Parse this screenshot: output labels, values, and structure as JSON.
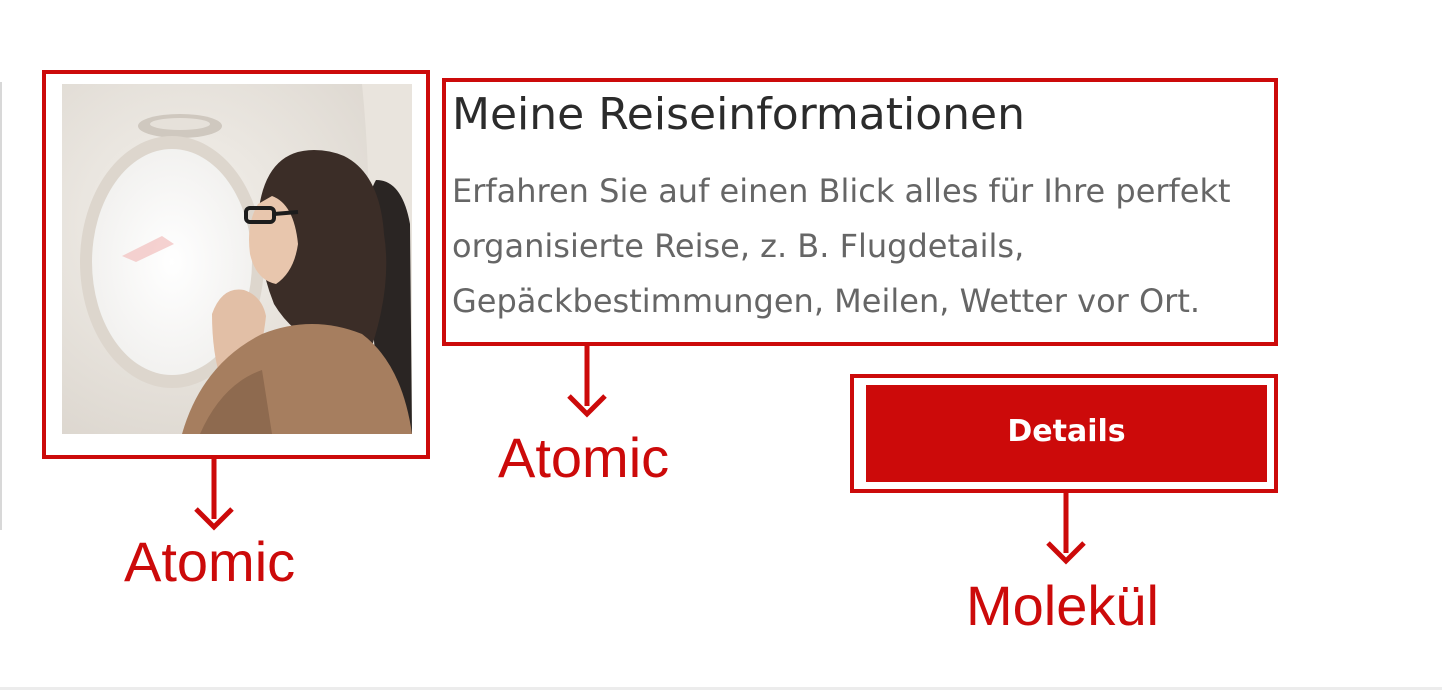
{
  "card": {
    "image_alt": "Frau mit Brille blickt im Flugzeug aus dem Fenster",
    "title": "Meine Reiseinformationen",
    "description": "Erfahren Sie auf einen Blick alles für Ihre perfekt organisierte Reise, z. B. Flugdetails, Gepäckbestimmungen, Meilen, Wetter vor Ort.",
    "button_label": "Details"
  },
  "annotations": {
    "image": "Atomic",
    "text": "Atomic",
    "button": "Molekül"
  },
  "colors": {
    "accent": "#cc0a0a",
    "title_text": "#2b2b2b",
    "body_text": "#666666",
    "background": "#ffffff"
  },
  "icons": [
    "arrow-down-icon"
  ]
}
